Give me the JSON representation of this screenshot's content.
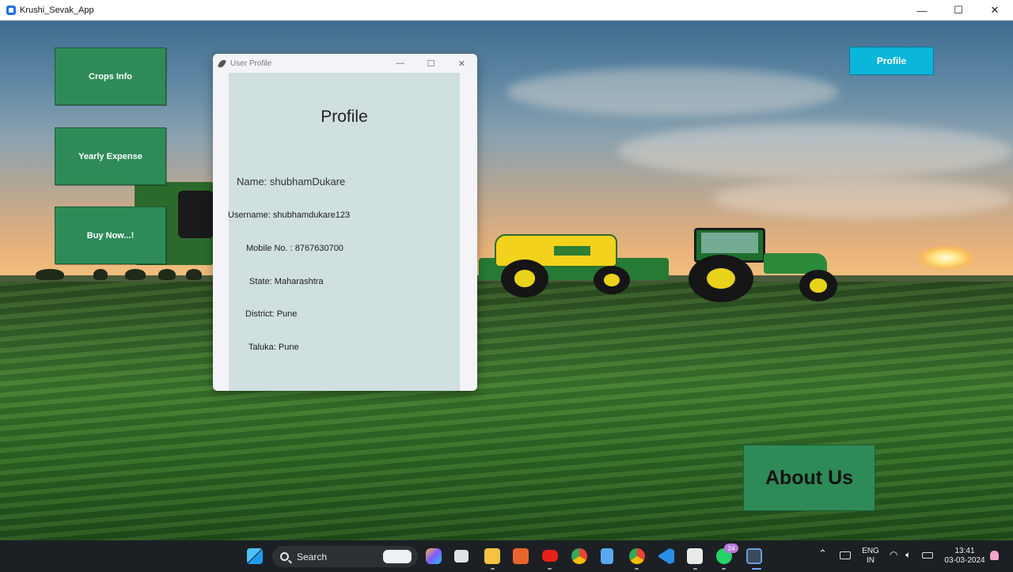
{
  "window": {
    "title": "Krushi_Sevak_App",
    "controls": {
      "minimize": "—",
      "maximize": "☐",
      "close": "✕"
    }
  },
  "sidebar": {
    "crops_info": "Crops Info",
    "yearly_expense": "Yearly Expense",
    "buy_now": "Buy Now...!"
  },
  "header": {
    "profile_button": "Profile"
  },
  "dialog": {
    "title": "User Profile",
    "controls": {
      "minimize": "—",
      "maximize": "☐",
      "close": "✕"
    },
    "heading": "Profile",
    "name": "Name: shubhamDukare",
    "username": "Username: shubhamdukare123",
    "mobile": "Mobile No. : 8767630700",
    "state": "State: Maharashtra",
    "district": "District: Pune",
    "taluka": "Taluka: Pune"
  },
  "about_us": "About Us",
  "taskbar": {
    "search_label": "Search",
    "language": "ENG",
    "region": "IN",
    "time": "13:41",
    "date": "03-03-2024",
    "whatsapp_badge": "24",
    "icons": [
      "windows-start-icon",
      "copilot-icon",
      "task-view-icon",
      "file-explorer-icon",
      "store-icon",
      "youtube-icon",
      "chrome-icon",
      "notepad-icon",
      "chrome-profile-icon",
      "vscode-icon",
      "snipping-tool-icon",
      "whatsapp-icon",
      "python-app-icon"
    ],
    "tray_icons": [
      "chevron-up-icon",
      "keyboard-icon",
      "wifi-icon",
      "volume-icon",
      "battery-icon",
      "notification-bell-icon"
    ]
  },
  "colors": {
    "green_button": "#2e8b57",
    "profile_button": "#0bb5dc",
    "dialog_body": "#d0dfe0",
    "taskbar": "#1c2024"
  }
}
